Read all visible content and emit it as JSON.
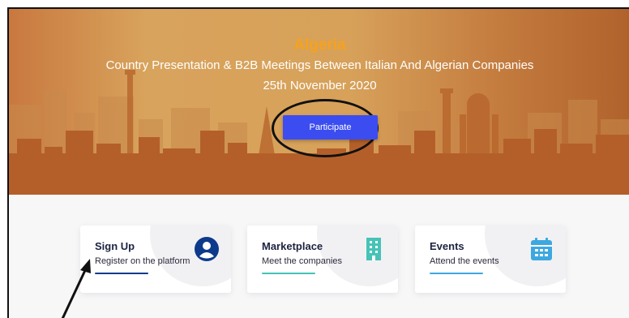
{
  "hero": {
    "title": "Algeria",
    "subtitle": "Country Presentation & B2B Meetings Between Italian And Algerian Companies",
    "date": "25th November 2020",
    "cta_label": "Participate"
  },
  "cards": [
    {
      "title": "Sign Up",
      "description": "Register on the platform",
      "icon": "user-circle-icon",
      "accent": "#0e3a8c"
    },
    {
      "title": "Marketplace",
      "description": "Meet the companies",
      "icon": "building-icon",
      "accent": "#46c3b6"
    },
    {
      "title": "Events",
      "description": "Attend the events",
      "icon": "calendar-icon",
      "accent": "#3da8e0"
    }
  ],
  "colors": {
    "hero_title": "#f6a21e",
    "button": "#3b4df0"
  }
}
